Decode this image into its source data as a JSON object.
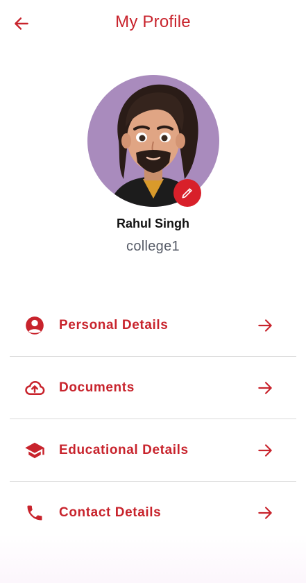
{
  "header": {
    "title": "My Profile",
    "back_icon": "arrow-left-icon"
  },
  "profile": {
    "name": "Rahul Singh",
    "college": "college1",
    "edit_icon": "pencil-icon",
    "avatar_bg": "#a98bbd"
  },
  "menu": {
    "items": [
      {
        "label": "Personal Details",
        "icon": "account-circle-icon"
      },
      {
        "label": "Documents",
        "icon": "cloud-upload-icon"
      },
      {
        "label": "Educational Details",
        "icon": "graduation-cap-icon"
      },
      {
        "label": "Contact Details",
        "icon": "phone-icon"
      }
    ],
    "arrow_icon": "arrow-right-icon"
  },
  "colors": {
    "accent": "#c8232c",
    "divider": "#d9d9d9",
    "secondary_text": "#555a66"
  }
}
